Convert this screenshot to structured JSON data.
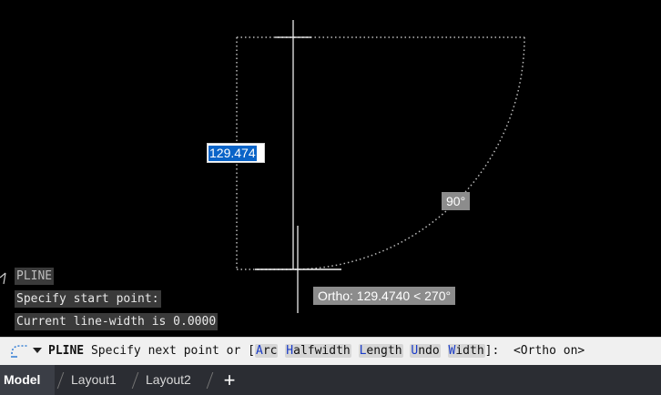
{
  "dynamic_input": {
    "value": "129.474"
  },
  "tooltips": {
    "angle": "90°",
    "ortho": "Ortho: 129.4740 < 270°"
  },
  "history": [
    "PLINE",
    "Specify start point:",
    "Current line-width is 0.0000"
  ],
  "command_line": {
    "icon": "command-line-icon",
    "command": "PLINE",
    "prompt": "Specify next point or [",
    "options": [
      {
        "key": "A",
        "rest": "rc"
      },
      {
        "key": "H",
        "rest": "alfwidth"
      },
      {
        "key": "L",
        "rest": "ength"
      },
      {
        "key": "U",
        "rest": "ndo"
      },
      {
        "key": "W",
        "rest": "idth"
      }
    ],
    "suffix": "]:  <Ortho on>"
  },
  "layout_tabs": [
    "Model",
    "Layout1",
    "Layout2"
  ],
  "add_tab_label": "+",
  "colors": {
    "canvas": "#000000",
    "selection": "#0a64c8",
    "option_key": "#1a3cc8",
    "tab_bar": "#2b2d33"
  }
}
